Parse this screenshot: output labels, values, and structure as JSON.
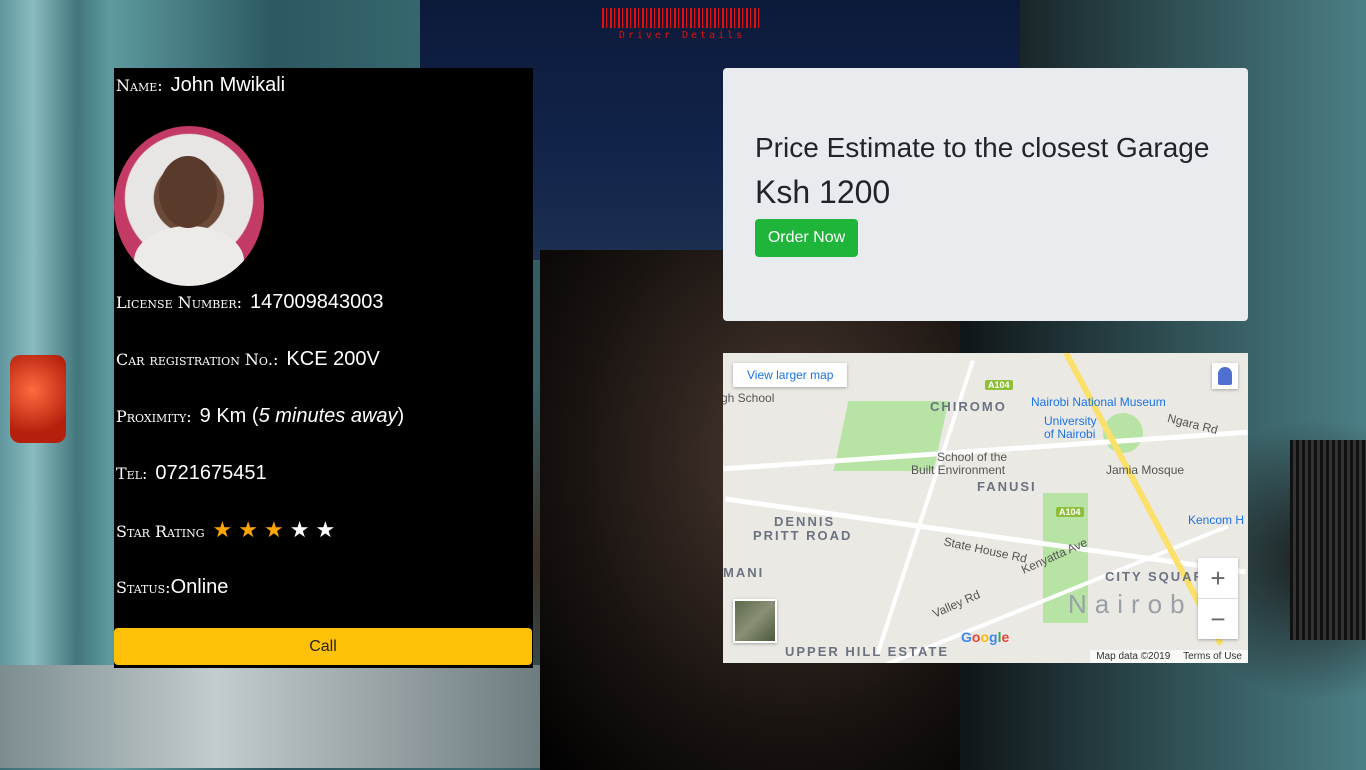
{
  "header": {
    "barcode_text": "Driver Details"
  },
  "driver": {
    "name_label": "Name:",
    "name": "John Mwikali",
    "license_label": "License Number:",
    "license": "147009843003",
    "car_reg_label": "Car registration No.:",
    "car_reg": "KCE 200V",
    "proximity_label": "Proximity:",
    "proximity_distance": "9 Km (",
    "proximity_time": "5 minutes away",
    "proximity_close": ")",
    "tel_label": "Tel:",
    "tel": "0721675451",
    "rating_label": "Star Rating",
    "rating": 3,
    "rating_max": 5,
    "status_label": "Status:",
    "status": "Online",
    "call_label": "Call"
  },
  "price": {
    "title": "Price Estimate to the closest Garage",
    "value": "Ksh 1200",
    "order_label": "Order Now"
  },
  "map": {
    "larger_map_label": "View larger map",
    "labels": {
      "school": "gh School",
      "chiromo": "CHIROMO",
      "museum": "Nairobi National Museum",
      "university_1": "University",
      "university_2": "of Nairobi",
      "ngara": "Ngara Rd",
      "built_env_1": "School of the",
      "built_env_2": "Built Environment",
      "fanusi": "FANUSI",
      "jamia": "Jamia Mosque",
      "kencom": "Kencom H",
      "dennis_1": "DENNIS",
      "dennis_2": "PRITT ROAD",
      "state_house": "State House Rd",
      "kenyatta": "Kenyatta Ave",
      "city_square": "CITY SQUARE",
      "mani": "MANI",
      "valley": "Valley Rd",
      "nairobi": "Nairob",
      "upper_hill": "UPPER HILL ESTATE",
      "a104_top": "A104",
      "a104_mid": "A104"
    },
    "google_logo": "Google",
    "map_data": "Map data ©2019",
    "terms": "Terms of Use",
    "zoom_in": "+",
    "zoom_out": "−"
  },
  "colors": {
    "call_button": "#ffc107",
    "order_button": "#1eb53a",
    "star_filled": "#ffa500",
    "star_empty": "#ffffff",
    "barcode": "#e01010"
  }
}
